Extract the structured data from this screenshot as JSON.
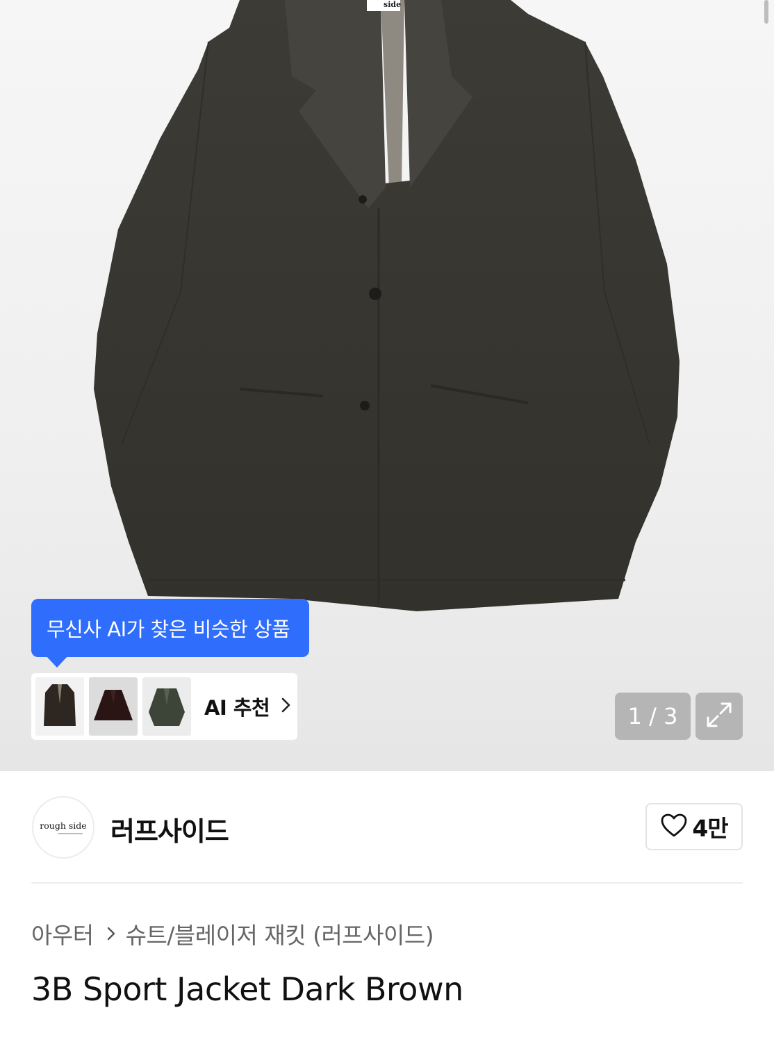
{
  "gallery": {
    "tooltip": "무신사 AI가 찾은 비슷한 상품",
    "ai_recommend_label": "AI 추천",
    "counter": "1 / 3",
    "image_tag_text": "side",
    "icons": [
      "chevron-right-icon",
      "expand-icon"
    ]
  },
  "brand": {
    "logo_text": "rough side",
    "name": "러프사이드",
    "like_count": "4만",
    "icons": [
      "heart-icon"
    ]
  },
  "category": {
    "parent": "아우터",
    "child": "슈트/블레이저 재킷 (러프사이드)"
  },
  "product": {
    "title": "3B Sport Jacket Dark Brown"
  },
  "colors": {
    "accent_blue": "#2f6dfc",
    "jacket": "#3a3832"
  }
}
